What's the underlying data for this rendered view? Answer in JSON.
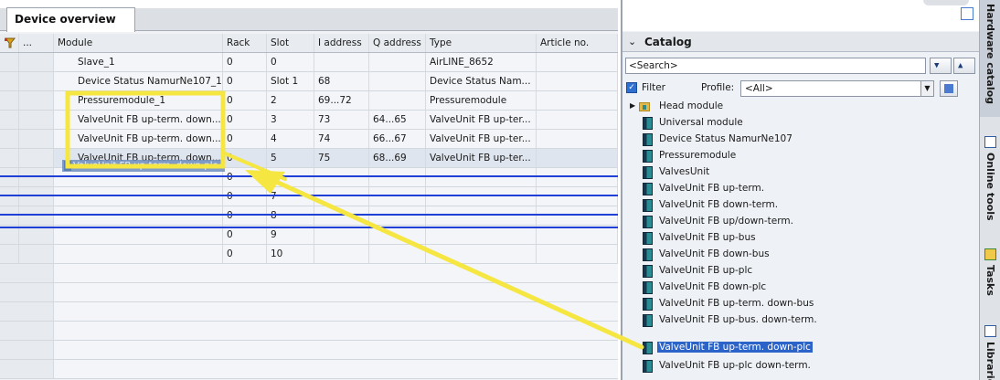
{
  "device_overview": {
    "tab_label": "Device overview",
    "columns": [
      "...",
      "Module",
      "Rack",
      "Slot",
      "I address",
      "Q address",
      "Type",
      "Article no."
    ],
    "rows": [
      {
        "module": "Slave_1",
        "rack": "0",
        "slot": "0",
        "i_address": "",
        "q_address": "",
        "type": "AirLINE_8652"
      },
      {
        "module": "Device Status NamurNe107_1",
        "rack": "0",
        "slot": "Slot 1",
        "i_address": "68",
        "q_address": "",
        "type": "Device Status Nam..."
      },
      {
        "module": "Pressuremodule_1",
        "rack": "0",
        "slot": "2",
        "i_address": "69...72",
        "q_address": "",
        "type": "Pressuremodule"
      },
      {
        "module": "ValveUnit FB up-term. down...",
        "rack": "0",
        "slot": "3",
        "i_address": "73",
        "q_address": "64...65",
        "type": "ValveUnit FB up-ter..."
      },
      {
        "module": "ValveUnit FB up-term. down...",
        "rack": "0",
        "slot": "4",
        "i_address": "74",
        "q_address": "66...67",
        "type": "ValveUnit FB up-ter..."
      },
      {
        "module": "ValveUnit FB up-term. down...",
        "rack": "0",
        "slot": "5",
        "i_address": "75",
        "q_address": "68...69",
        "type": "ValveUnit FB up-ter..."
      },
      {
        "module": "",
        "rack": "0",
        "slot": "6",
        "i_address": "",
        "q_address": "",
        "type": ""
      },
      {
        "module": "",
        "rack": "0",
        "slot": "7",
        "i_address": "",
        "q_address": "",
        "type": ""
      },
      {
        "module": "",
        "rack": "0",
        "slot": "8",
        "i_address": "",
        "q_address": "",
        "type": ""
      },
      {
        "module": "",
        "rack": "0",
        "slot": "9",
        "i_address": "",
        "q_address": "",
        "type": ""
      },
      {
        "module": "",
        "rack": "0",
        "slot": "10",
        "i_address": "",
        "q_address": "",
        "type": ""
      }
    ],
    "drag_ghost_text": "ValveUnit FB up-term. down-plc"
  },
  "catalog": {
    "title": "Catalog",
    "search_placeholder": "<Search>",
    "filter_label": "Filter",
    "profile_label": "Profile:",
    "profile_value": "<All>",
    "items": [
      {
        "label": "Head module",
        "kind": "folder"
      },
      {
        "label": "Universal module",
        "kind": "module"
      },
      {
        "label": "Device Status NamurNe107",
        "kind": "module"
      },
      {
        "label": "Pressuremodule",
        "kind": "module"
      },
      {
        "label": "ValvesUnit",
        "kind": "module"
      },
      {
        "label": "ValveUnit FB up-term.",
        "kind": "module"
      },
      {
        "label": "ValveUnit FB down-term.",
        "kind": "module"
      },
      {
        "label": "ValveUnit FB up/down-term.",
        "kind": "module"
      },
      {
        "label": "ValveUnit FB up-bus",
        "kind": "module"
      },
      {
        "label": "ValveUnit FB down-bus",
        "kind": "module"
      },
      {
        "label": "ValveUnit FB up-plc",
        "kind": "module"
      },
      {
        "label": "ValveUnit FB down-plc",
        "kind": "module"
      },
      {
        "label": "ValveUnit FB up-term. down-bus",
        "kind": "module"
      },
      {
        "label": "ValveUnit FB up-bus. down-term.",
        "kind": "module"
      },
      {
        "label": "ValveUnit FB up-term. down-plc",
        "kind": "module",
        "highlighted": true
      },
      {
        "label": "ValveUnit FB up-plc down-term.",
        "kind": "module"
      }
    ]
  },
  "side_tabs": {
    "hardware_catalog": "Hardware catalog",
    "online_tools": "Online tools",
    "tasks": "Tasks",
    "libraries": "Libraries"
  },
  "colors": {
    "annotation_yellow": "#f5e642",
    "insert_line_blue": "#1f3fd6",
    "highlight_blue": "#2b63c9"
  }
}
